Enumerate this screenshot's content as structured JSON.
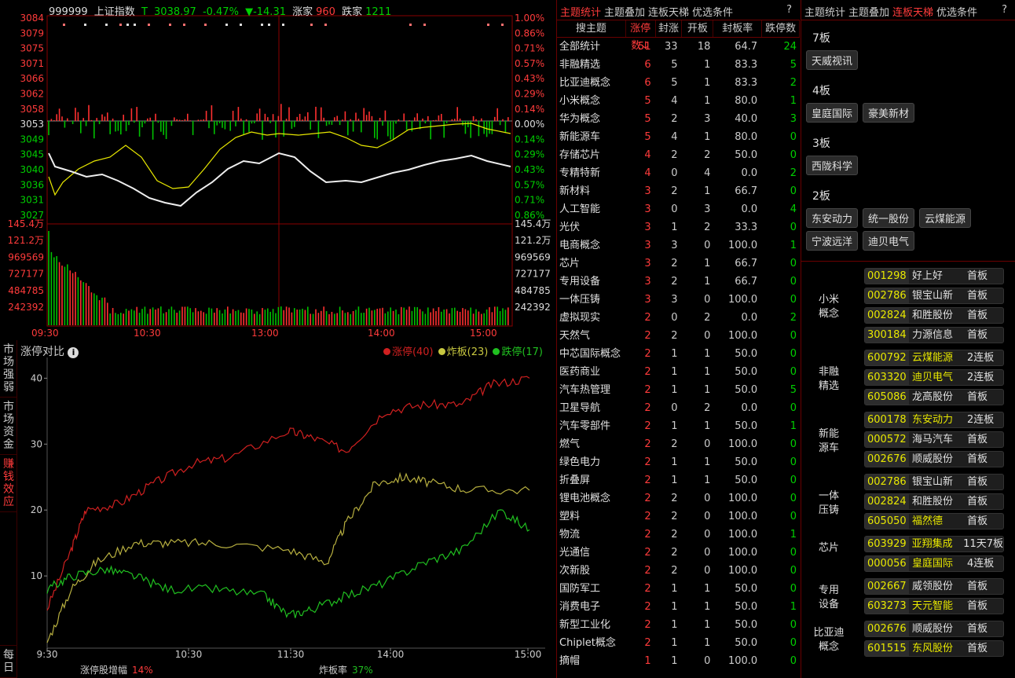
{
  "index_header": {
    "code": "999999",
    "name": "上证指数",
    "t": "T",
    "price": "3038.97",
    "pct": "-0.47%",
    "chg": "▼-14.31",
    "up_label": "涨家",
    "up": "960",
    "down_label": "跌家",
    "down": "1211"
  },
  "price_ticks": [
    "3084",
    "3079",
    "3075",
    "3071",
    "3066",
    "3062",
    "3058",
    "3053",
    "3049",
    "3045",
    "3040",
    "3036",
    "3031",
    "3027"
  ],
  "pct_ticks": [
    "1.00%",
    "0.86%",
    "0.71%",
    "0.57%",
    "0.43%",
    "0.29%",
    "0.14%",
    "0.00%",
    "0.14%",
    "0.29%",
    "0.43%",
    "0.57%",
    "0.71%",
    "0.86%"
  ],
  "vol_ticks": [
    "145.4万",
    "121.2万",
    "969569",
    "727177",
    "484785",
    "242392"
  ],
  "time_ticks": [
    "09:30",
    "10:30",
    "13:00",
    "14:00",
    "15:00"
  ],
  "side_tabs": [
    "市场强弱",
    "市场资金",
    "赚钱效应",
    "每日"
  ],
  "limit_compare": {
    "title": "涨停对比",
    "legend": [
      {
        "label": "涨停(40)",
        "color": "#d02020"
      },
      {
        "label": "炸板(23)",
        "color": "#c8c840"
      },
      {
        "label": "跌停(17)",
        "color": "#20c020"
      }
    ],
    "y_ticks": [
      "40",
      "30",
      "20",
      "10"
    ],
    "x_ticks": [
      "9:30",
      "10:30",
      "11:30",
      "14:00",
      "15:00"
    ],
    "footer_left_label": "涨停股增幅",
    "footer_left_value": "14%",
    "footer_right_label": "炸板率",
    "footer_right_value": "37%"
  },
  "chart_data": {
    "type": "line",
    "x": [
      "9:30",
      "10:30",
      "11:30",
      "14:00",
      "15:00"
    ],
    "ylim": [
      0,
      41
    ],
    "series": [
      {
        "name": "涨停",
        "values": [
          0,
          20,
          23,
          30,
          40
        ]
      },
      {
        "name": "炸板",
        "values": [
          0,
          15,
          15,
          24,
          23
        ]
      },
      {
        "name": "跌停",
        "values": [
          0,
          10,
          5,
          11,
          17
        ]
      }
    ]
  },
  "theme_tabs": [
    "主题统计",
    "主题叠加",
    "连板天梯",
    "优选条件",
    "?"
  ],
  "theme_table": {
    "headers": [
      "搜主题",
      "涨停数↓",
      "封涨",
      "开板",
      "封板率",
      "跌停数"
    ],
    "rows": [
      [
        "全部统计",
        "51",
        "33",
        "18",
        "64.7",
        "24"
      ],
      [
        "非融精选",
        "6",
        "5",
        "1",
        "83.3",
        "5"
      ],
      [
        "比亚迪概念",
        "6",
        "5",
        "1",
        "83.3",
        "2"
      ],
      [
        "小米概念",
        "5",
        "4",
        "1",
        "80.0",
        "1"
      ],
      [
        "华为概念",
        "5",
        "2",
        "3",
        "40.0",
        "3"
      ],
      [
        "新能源车",
        "5",
        "4",
        "1",
        "80.0",
        "0"
      ],
      [
        "存储芯片",
        "4",
        "2",
        "2",
        "50.0",
        "0"
      ],
      [
        "专精特新",
        "4",
        "0",
        "4",
        "0.0",
        "2"
      ],
      [
        "新材料",
        "3",
        "2",
        "1",
        "66.7",
        "0"
      ],
      [
        "人工智能",
        "3",
        "0",
        "3",
        "0.0",
        "4"
      ],
      [
        "光伏",
        "3",
        "1",
        "2",
        "33.3",
        "0"
      ],
      [
        "电商概念",
        "3",
        "3",
        "0",
        "100.0",
        "1"
      ],
      [
        "芯片",
        "3",
        "2",
        "1",
        "66.7",
        "0"
      ],
      [
        "专用设备",
        "3",
        "2",
        "1",
        "66.7",
        "0"
      ],
      [
        "一体压铸",
        "3",
        "3",
        "0",
        "100.0",
        "0"
      ],
      [
        "虚拟现实",
        "2",
        "0",
        "2",
        "0.0",
        "2"
      ],
      [
        "天然气",
        "2",
        "2",
        "0",
        "100.0",
        "0"
      ],
      [
        "中芯国际概念",
        "2",
        "1",
        "1",
        "50.0",
        "0"
      ],
      [
        "医药商业",
        "2",
        "1",
        "1",
        "50.0",
        "0"
      ],
      [
        "汽车热管理",
        "2",
        "1",
        "1",
        "50.0",
        "5"
      ],
      [
        "卫星导航",
        "2",
        "0",
        "2",
        "0.0",
        "0"
      ],
      [
        "汽车零部件",
        "2",
        "1",
        "1",
        "50.0",
        "1"
      ],
      [
        "燃气",
        "2",
        "2",
        "0",
        "100.0",
        "0"
      ],
      [
        "绿色电力",
        "2",
        "1",
        "1",
        "50.0",
        "0"
      ],
      [
        "折叠屏",
        "2",
        "1",
        "1",
        "50.0",
        "0"
      ],
      [
        "锂电池概念",
        "2",
        "2",
        "0",
        "100.0",
        "0"
      ],
      [
        "塑料",
        "2",
        "2",
        "0",
        "100.0",
        "0"
      ],
      [
        "物流",
        "2",
        "2",
        "0",
        "100.0",
        "1"
      ],
      [
        "光通信",
        "2",
        "2",
        "0",
        "100.0",
        "0"
      ],
      [
        "次新股",
        "2",
        "2",
        "0",
        "100.0",
        "0"
      ],
      [
        "国防军工",
        "2",
        "1",
        "1",
        "50.0",
        "0"
      ],
      [
        "消费电子",
        "2",
        "1",
        "1",
        "50.0",
        "1"
      ],
      [
        "新型工业化",
        "2",
        "1",
        "1",
        "50.0",
        "0"
      ],
      [
        "Chiplet概念",
        "2",
        "1",
        "1",
        "50.0",
        "0"
      ],
      [
        "摘帽",
        "1",
        "1",
        "0",
        "100.0",
        "0"
      ]
    ]
  },
  "ladder_tabs": [
    "主题统计",
    "主题叠加",
    "连板天梯",
    "优选条件",
    "?"
  ],
  "ladder": [
    {
      "level": "7板",
      "stocks": [
        "天威视讯"
      ]
    },
    {
      "level": "4板",
      "stocks": [
        "皇庭国际",
        "豪美新材"
      ]
    },
    {
      "level": "3板",
      "stocks": [
        "西陇科学"
      ]
    },
    {
      "level": "2板",
      "stocks": [
        "东安动力",
        "统一股份",
        "云煤能源",
        "宁波远洋",
        "迪贝电气"
      ]
    }
  ],
  "groups": [
    {
      "name": "小米概念",
      "stocks": [
        [
          "001298",
          "好上好",
          "首板"
        ],
        [
          "002786",
          "银宝山新",
          "首板"
        ],
        [
          "002824",
          "和胜股份",
          "首板"
        ],
        [
          "300184",
          "力源信息",
          "首板"
        ]
      ]
    },
    {
      "name": "非融精选",
      "stocks": [
        [
          "600792",
          "云煤能源",
          "2连板"
        ],
        [
          "603320",
          "迪贝电气",
          "2连板"
        ],
        [
          "605086",
          "龙高股份",
          "首板"
        ]
      ]
    },
    {
      "name": "新能源车",
      "stocks": [
        [
          "600178",
          "东安动力",
          "2连板"
        ],
        [
          "000572",
          "海马汽车",
          "首板"
        ],
        [
          "002676",
          "顺威股份",
          "首板"
        ]
      ]
    },
    {
      "name": "一体压铸",
      "stocks": [
        [
          "002786",
          "银宝山新",
          "首板"
        ],
        [
          "002824",
          "和胜股份",
          "首板"
        ],
        [
          "605050",
          "福然德",
          "首板"
        ]
      ]
    },
    {
      "name": "芯片",
      "stocks": [
        [
          "603929",
          "亚翔集成",
          "11天7板"
        ],
        [
          "000056",
          "皇庭国际",
          "4连板"
        ]
      ]
    },
    {
      "name": "专用设备",
      "stocks": [
        [
          "002667",
          "威领股份",
          "首板"
        ],
        [
          "603273",
          "天元智能",
          "首板"
        ]
      ]
    },
    {
      "name": "比亚迪概念",
      "stocks": [
        [
          "002676",
          "顺威股份",
          "首板"
        ],
        [
          "601515",
          "东风股份",
          "首板"
        ]
      ]
    }
  ]
}
